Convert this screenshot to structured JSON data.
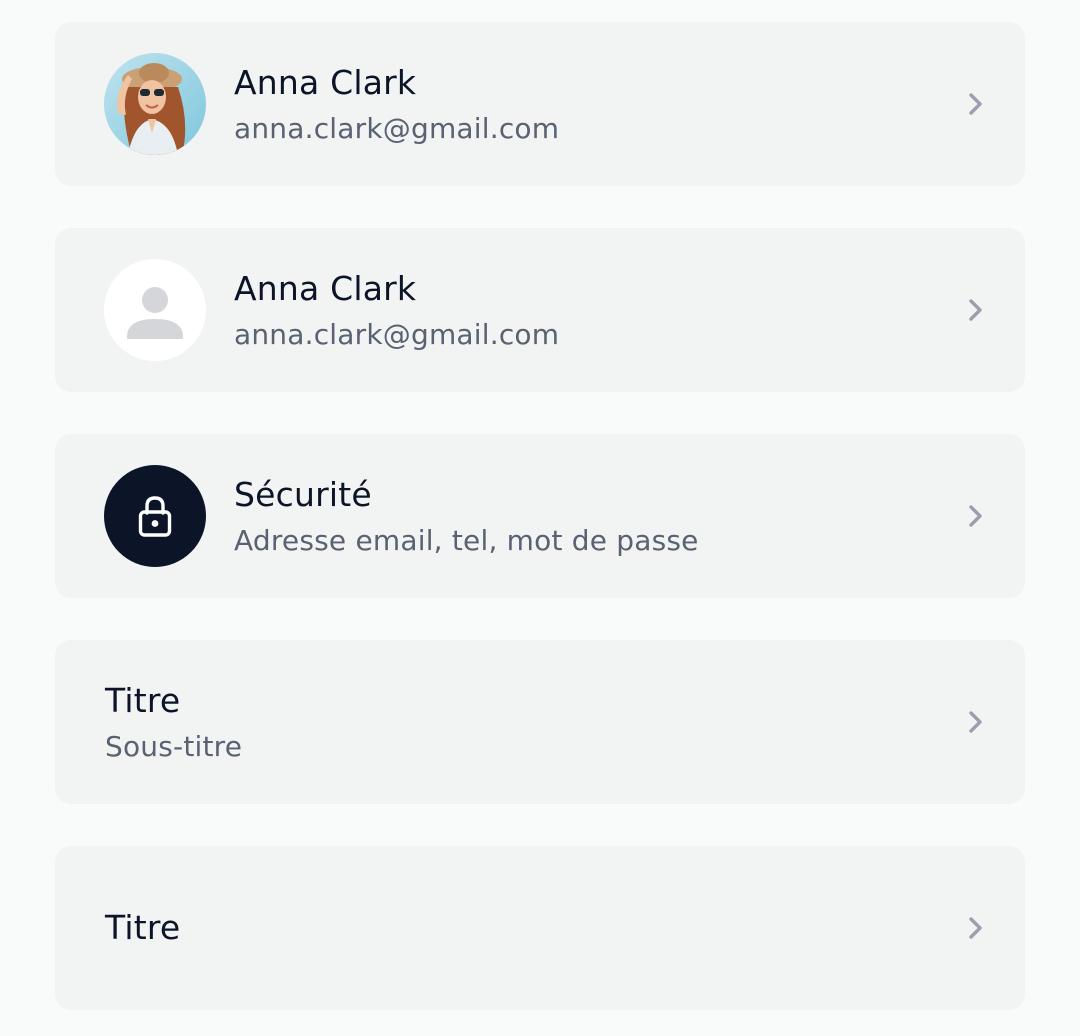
{
  "items": [
    {
      "title": "Anna Clark",
      "subtitle": "anna.clark@gmail.com",
      "avatar": "photo-avatar",
      "trailing_icon": "chevron-right-icon"
    },
    {
      "title": "Anna Clark",
      "subtitle": "anna.clark@gmail.com",
      "avatar": "person-placeholder-icon",
      "trailing_icon": "chevron-right-icon"
    },
    {
      "title": "Sécurité",
      "subtitle": "Adresse email, tel, mot de passe",
      "avatar": "lock-icon",
      "trailing_icon": "chevron-right-icon"
    },
    {
      "title": "Titre",
      "subtitle": "Sous-titre",
      "trailing_icon": "chevron-right-icon"
    },
    {
      "title": "Titre",
      "trailing_icon": "chevron-right-icon"
    }
  ],
  "colors": {
    "page_background": "#f9fafa",
    "card_background": "#f2f4f4",
    "title": "#0b1527",
    "subtitle": "#5a6272",
    "chevron": "#9aa0ab",
    "lock_avatar_background": "#0b1527",
    "placeholder_avatar_background": "#ffffff",
    "placeholder_figure": "#d4d6d9"
  }
}
